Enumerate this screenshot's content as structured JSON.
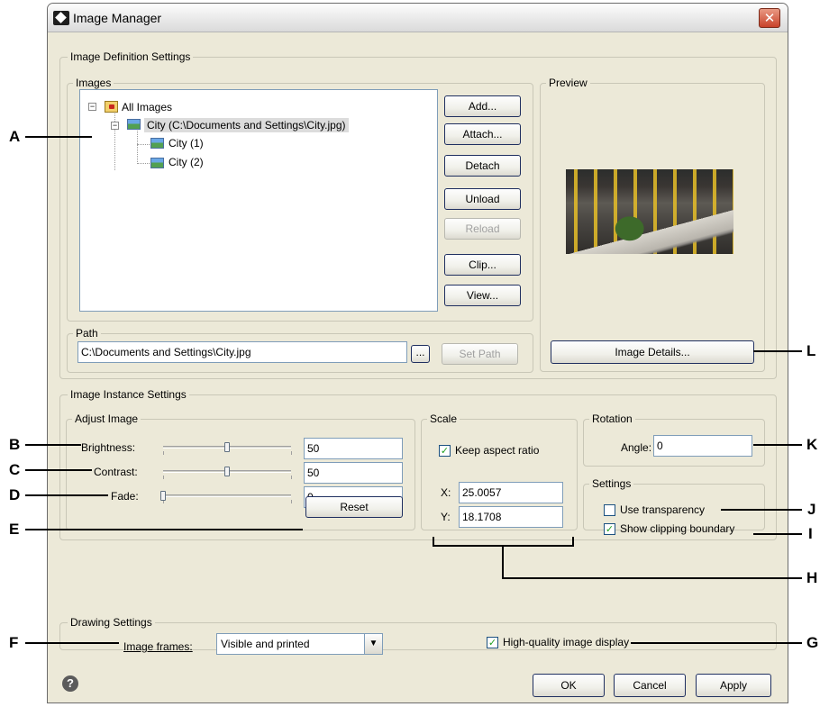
{
  "window": {
    "title": "Image Manager",
    "close_symbol": "✕"
  },
  "definition": {
    "group_label": "Image Definition Settings",
    "images_label": "Images",
    "tree": {
      "root": "All Images",
      "image": "City  (C:\\Documents and Settings\\City.jpg)",
      "instances": [
        "City (1)",
        "City (2)"
      ],
      "expander": "−"
    },
    "buttons": {
      "add": "Add...",
      "attach": "Attach...",
      "detach": "Detach",
      "unload": "Unload",
      "reload": "Reload",
      "clip": "Clip...",
      "view": "View..."
    },
    "path_label": "Path",
    "path_value": "C:\\Documents and Settings\\City.jpg",
    "browse_label": "...",
    "set_path_label": "Set Path",
    "preview_label": "Preview",
    "image_details_label": "Image Details..."
  },
  "instance": {
    "group_label": "Image Instance Settings",
    "adjust": {
      "label": "Adjust Image",
      "brightness_label": "Brightness:",
      "brightness_value": "50",
      "brightness_level": 0.5,
      "contrast_label": "Contrast:",
      "contrast_value": "50",
      "contrast_level": 0.5,
      "fade_label": "Fade:",
      "fade_value": "0",
      "fade_level": 0,
      "reset_label": "Reset"
    },
    "scale": {
      "label": "Scale",
      "keep_aspect_label": "Keep aspect ratio",
      "keep_aspect_checked": true,
      "x_label": "X:",
      "x_value": "25.0057",
      "y_label": "Y:",
      "y_value": "18.1708"
    },
    "rotation": {
      "label": "Rotation",
      "angle_label": "Angle:",
      "angle_value": "0"
    },
    "settings": {
      "label": "Settings",
      "use_transparency_label": "Use transparency",
      "use_transparency_checked": false,
      "show_clipping_label": "Show clipping boundary",
      "show_clipping_checked": true
    }
  },
  "drawing": {
    "group_label": "Drawing Settings",
    "image_frames_label": "Image frames:",
    "image_frames_value": "Visible and printed",
    "high_quality_label": "High-quality image display",
    "high_quality_checked": true
  },
  "footer": {
    "help_symbol": "?",
    "ok_label": "OK",
    "cancel_label": "Cancel",
    "apply_label": "Apply"
  },
  "callouts": {
    "a": "A",
    "b": "B",
    "c": "C",
    "d": "D",
    "e": "E",
    "f": "F",
    "g": "G",
    "h": "H",
    "i": "I",
    "j": "J",
    "k": "K",
    "l": "L"
  },
  "colors": {
    "dialog_bg": "#ece9d8",
    "button_border": "#1f2f60",
    "checkmark": "#21a121",
    "close_button": "#c9422a"
  }
}
